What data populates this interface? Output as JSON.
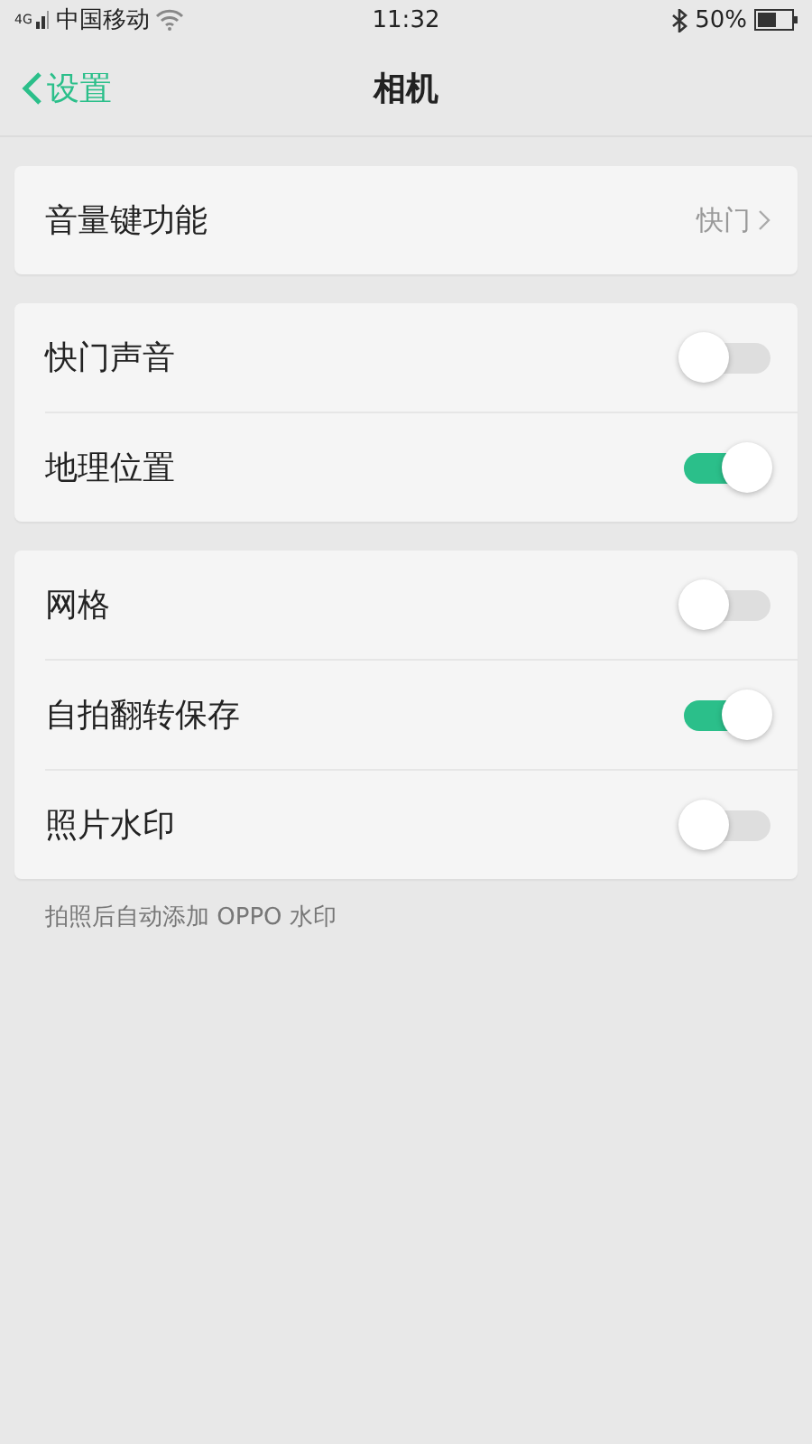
{
  "status_bar": {
    "network": "4G",
    "carrier": "中国移动",
    "time": "11:32",
    "battery": "50%"
  },
  "nav": {
    "back": "设置",
    "title": "相机"
  },
  "groups": [
    {
      "rows": [
        {
          "kind": "link",
          "label": "音量键功能",
          "value": "快门"
        }
      ]
    },
    {
      "rows": [
        {
          "kind": "toggle",
          "label": "快门声音",
          "on": false
        },
        {
          "kind": "toggle",
          "label": "地理位置",
          "on": true
        }
      ]
    },
    {
      "rows": [
        {
          "kind": "toggle",
          "label": "网格",
          "on": false
        },
        {
          "kind": "toggle",
          "label": "自拍翻转保存",
          "on": true
        },
        {
          "kind": "toggle",
          "label": "照片水印",
          "on": false
        }
      ],
      "footnote": "拍照后自动添加 OPPO 水印"
    }
  ]
}
